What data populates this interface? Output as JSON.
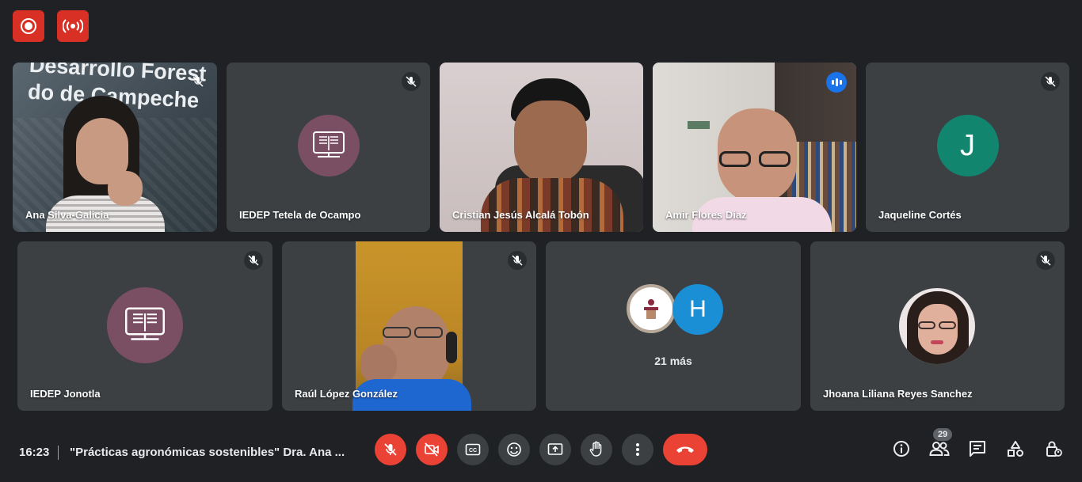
{
  "top_indicators": [
    {
      "name": "recording",
      "icon": "record-icon"
    },
    {
      "name": "live-stream",
      "icon": "broadcast-icon"
    }
  ],
  "participants": [
    {
      "name": "Ana Silva-Galicia",
      "muted": true,
      "kind": "video",
      "background_text": "Desarrollo Forest\ndo de Campeche"
    },
    {
      "name": "IEDEP Tetela de Ocampo",
      "muted": true,
      "kind": "avatar-book"
    },
    {
      "name": "Cristian Jesús Alcalá Tobón",
      "muted": false,
      "kind": "video"
    },
    {
      "name": "Amir Flores Díaz",
      "muted": false,
      "speaking": true,
      "kind": "video"
    },
    {
      "name": "Jaqueline Cortés",
      "muted": true,
      "kind": "avatar-letter",
      "initial": "J",
      "color": "#12856f"
    },
    {
      "name": "IEDEP Jonotla",
      "muted": true,
      "kind": "avatar-book"
    },
    {
      "name": "Raúl López González",
      "muted": true,
      "kind": "video"
    },
    {
      "name": "",
      "muted": false,
      "kind": "group",
      "initial": "H",
      "color": "#1a8fd6",
      "more_label": "21 más"
    },
    {
      "name": "Jhoana Liliana Reyes Sanchez",
      "muted": true,
      "kind": "avatar-photo"
    }
  ],
  "bottom_bar": {
    "time": "16:23",
    "meeting_title": "\"Prácticas agronómicas sostenibles\" Dra. Ana ...",
    "controls": [
      "mic-off",
      "camera-off",
      "captions",
      "reactions",
      "present",
      "raise-hand",
      "more",
      "end-call"
    ],
    "participant_count": "29"
  },
  "colors": {
    "background": "#202124",
    "tile": "#3c4043",
    "danger": "#ea4335",
    "active_outline": "#8ab4f8",
    "book_avatar": "#7a4f63"
  }
}
